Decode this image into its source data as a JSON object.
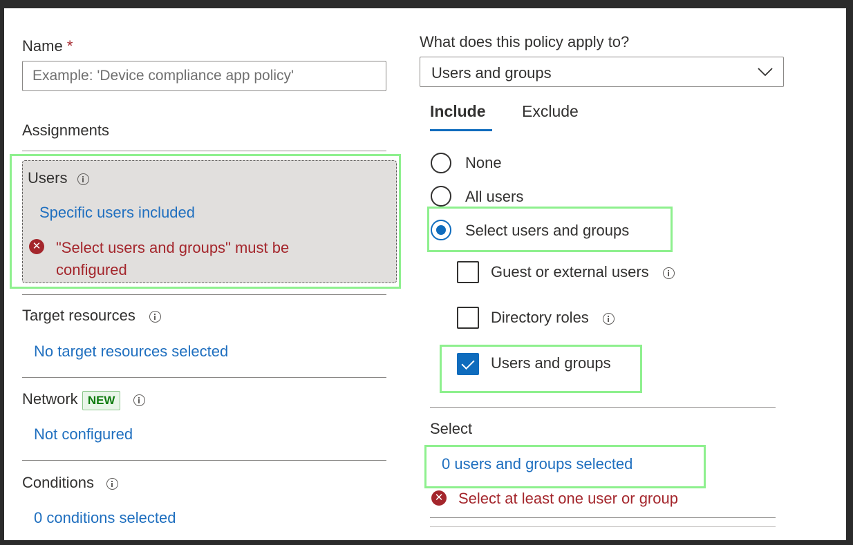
{
  "left": {
    "name_label": "Name",
    "name_required": "*",
    "name_placeholder": "Example: 'Device compliance app policy'",
    "assignments_label": "Assignments",
    "users": {
      "label": "Users",
      "link": "Specific users included",
      "error_line1": "\"Select users and groups\" must be",
      "error_line2": "configured"
    },
    "target_resources": {
      "label": "Target resources",
      "link": "No target resources selected"
    },
    "network": {
      "label": "Network",
      "badge": "NEW",
      "link": "Not configured"
    },
    "conditions": {
      "label": "Conditions",
      "link": "0 conditions selected"
    }
  },
  "right": {
    "question": "What does this policy apply to?",
    "dropdown_value": "Users and groups",
    "tabs": [
      {
        "label": "Include",
        "active": true
      },
      {
        "label": "Exclude",
        "active": false
      }
    ],
    "radios": [
      {
        "label": "None",
        "selected": false
      },
      {
        "label": "All users",
        "selected": false
      },
      {
        "label": "Select users and groups",
        "selected": true
      }
    ],
    "checkboxes": [
      {
        "label": "Guest or external users",
        "checked": false
      },
      {
        "label": "Directory roles",
        "checked": false
      },
      {
        "label": "Users and groups",
        "checked": true
      }
    ],
    "select_label": "Select",
    "select_link": "0 users and groups selected",
    "select_error": "Select at least one user or group"
  },
  "colors": {
    "link": "#1f6fbf",
    "error": "#a4262c",
    "accent": "#0f6cbd",
    "highlight": "#8ef08e",
    "users_card_bg": "#e1dfdd"
  }
}
